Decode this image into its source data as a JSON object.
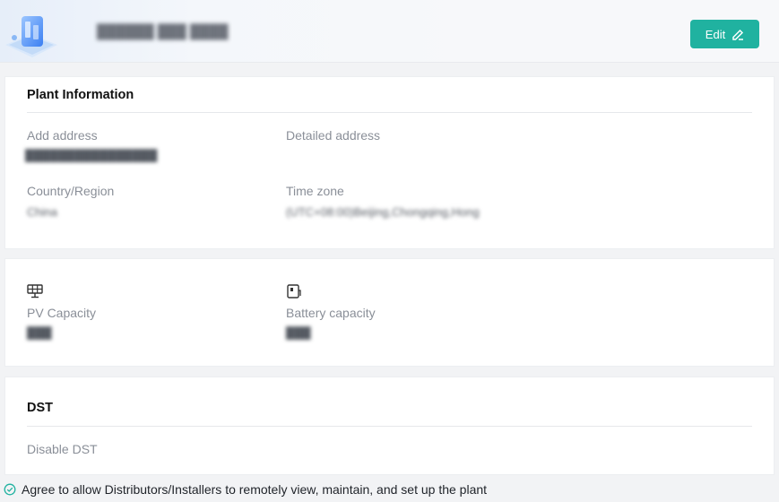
{
  "header": {
    "plant_name": "██████ ███ ████",
    "edit_label": "Edit"
  },
  "plant_info": {
    "title": "Plant Information",
    "add_address_label": "Add address",
    "add_address_value": "████████████████",
    "detailed_address_label": "Detailed address",
    "country_label": "Country/Region",
    "country_value": "China",
    "timezone_label": "Time zone",
    "timezone_value": "(UTC+08:00)Beijing,Chongqing,Hong"
  },
  "capacity": {
    "pv_label": "PV Capacity",
    "pv_value": "███",
    "battery_label": "Battery capacity",
    "battery_value": "███"
  },
  "dst": {
    "title": "DST",
    "status": "Disable DST"
  },
  "footer": {
    "agreement": "Agree to allow Distributors/Installers to remotely view, maintain, and set up the plant"
  },
  "colors": {
    "accent": "#20b2a0",
    "label": "#8a8f98",
    "check": "#20b2a0"
  },
  "icons": [
    "plant-logo-icon",
    "pencil-icon",
    "solar-panel-icon",
    "battery-icon",
    "check-circle-icon"
  ]
}
